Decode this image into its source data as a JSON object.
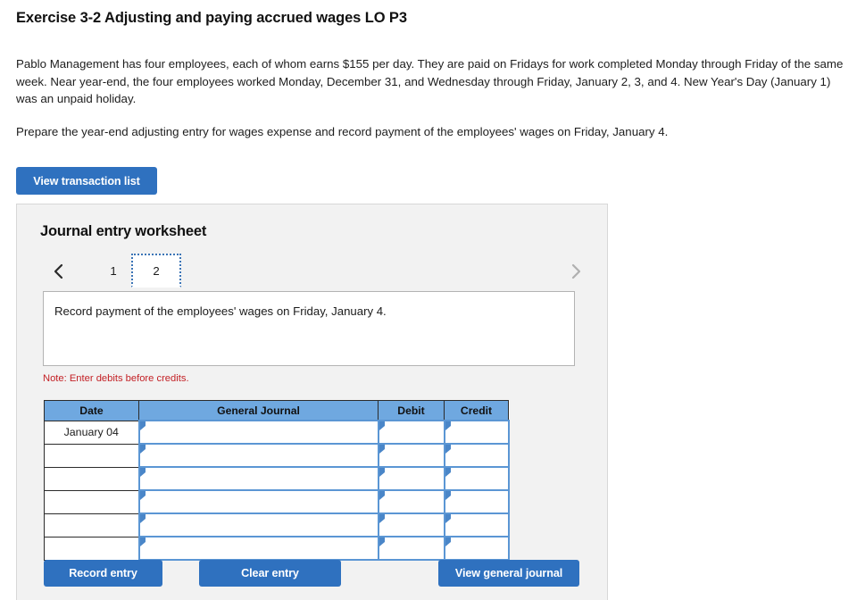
{
  "exercise": {
    "title": "Exercise 3-2 Adjusting and paying accrued wages LO P3",
    "paragraph_1": "Pablo Management has four employees, each of whom earns $155 per day. They are paid on Fridays for work completed Monday through Friday of the same week. Near year-end, the four employees worked Monday, December 31, and Wednesday through Friday, January 2, 3, and 4. New Year's Day (January 1) was an unpaid holiday.",
    "paragraph_2": "Prepare the year-end adjusting entry for wages expense and record payment of the employees' wages on Friday, January 4."
  },
  "toolbar": {
    "view_transaction_list_label": "View transaction list"
  },
  "worksheet": {
    "title": "Journal entry worksheet",
    "pager": {
      "prev_icon": "chevron-left-icon",
      "next_icon": "chevron-right-icon",
      "tabs": [
        {
          "label": "1",
          "selected": false
        },
        {
          "label": "2",
          "selected": true
        }
      ]
    },
    "description": "Record payment of the employees' wages on Friday, January 4.",
    "note": "Note: Enter debits before credits.",
    "table": {
      "columns": [
        "Date",
        "General Journal",
        "Debit",
        "Credit"
      ],
      "rows": [
        {
          "date": "January 04",
          "general_journal": "",
          "debit": "",
          "credit": ""
        },
        {
          "date": "",
          "general_journal": "",
          "debit": "",
          "credit": ""
        },
        {
          "date": "",
          "general_journal": "",
          "debit": "",
          "credit": ""
        },
        {
          "date": "",
          "general_journal": "",
          "debit": "",
          "credit": ""
        },
        {
          "date": "",
          "general_journal": "",
          "debit": "",
          "credit": ""
        },
        {
          "date": "",
          "general_journal": "",
          "debit": "",
          "credit": ""
        }
      ]
    },
    "actions": {
      "record_entry_label": "Record entry",
      "clear_entry_label": "Clear entry",
      "view_general_journal_label": "View general journal"
    }
  },
  "colors": {
    "button_blue": "#2f71bf",
    "table_header_blue": "#6fa8e0",
    "input_border_blue": "#5b96d4",
    "note_red": "#c32025",
    "panel_gray": "#f2f2f2"
  }
}
